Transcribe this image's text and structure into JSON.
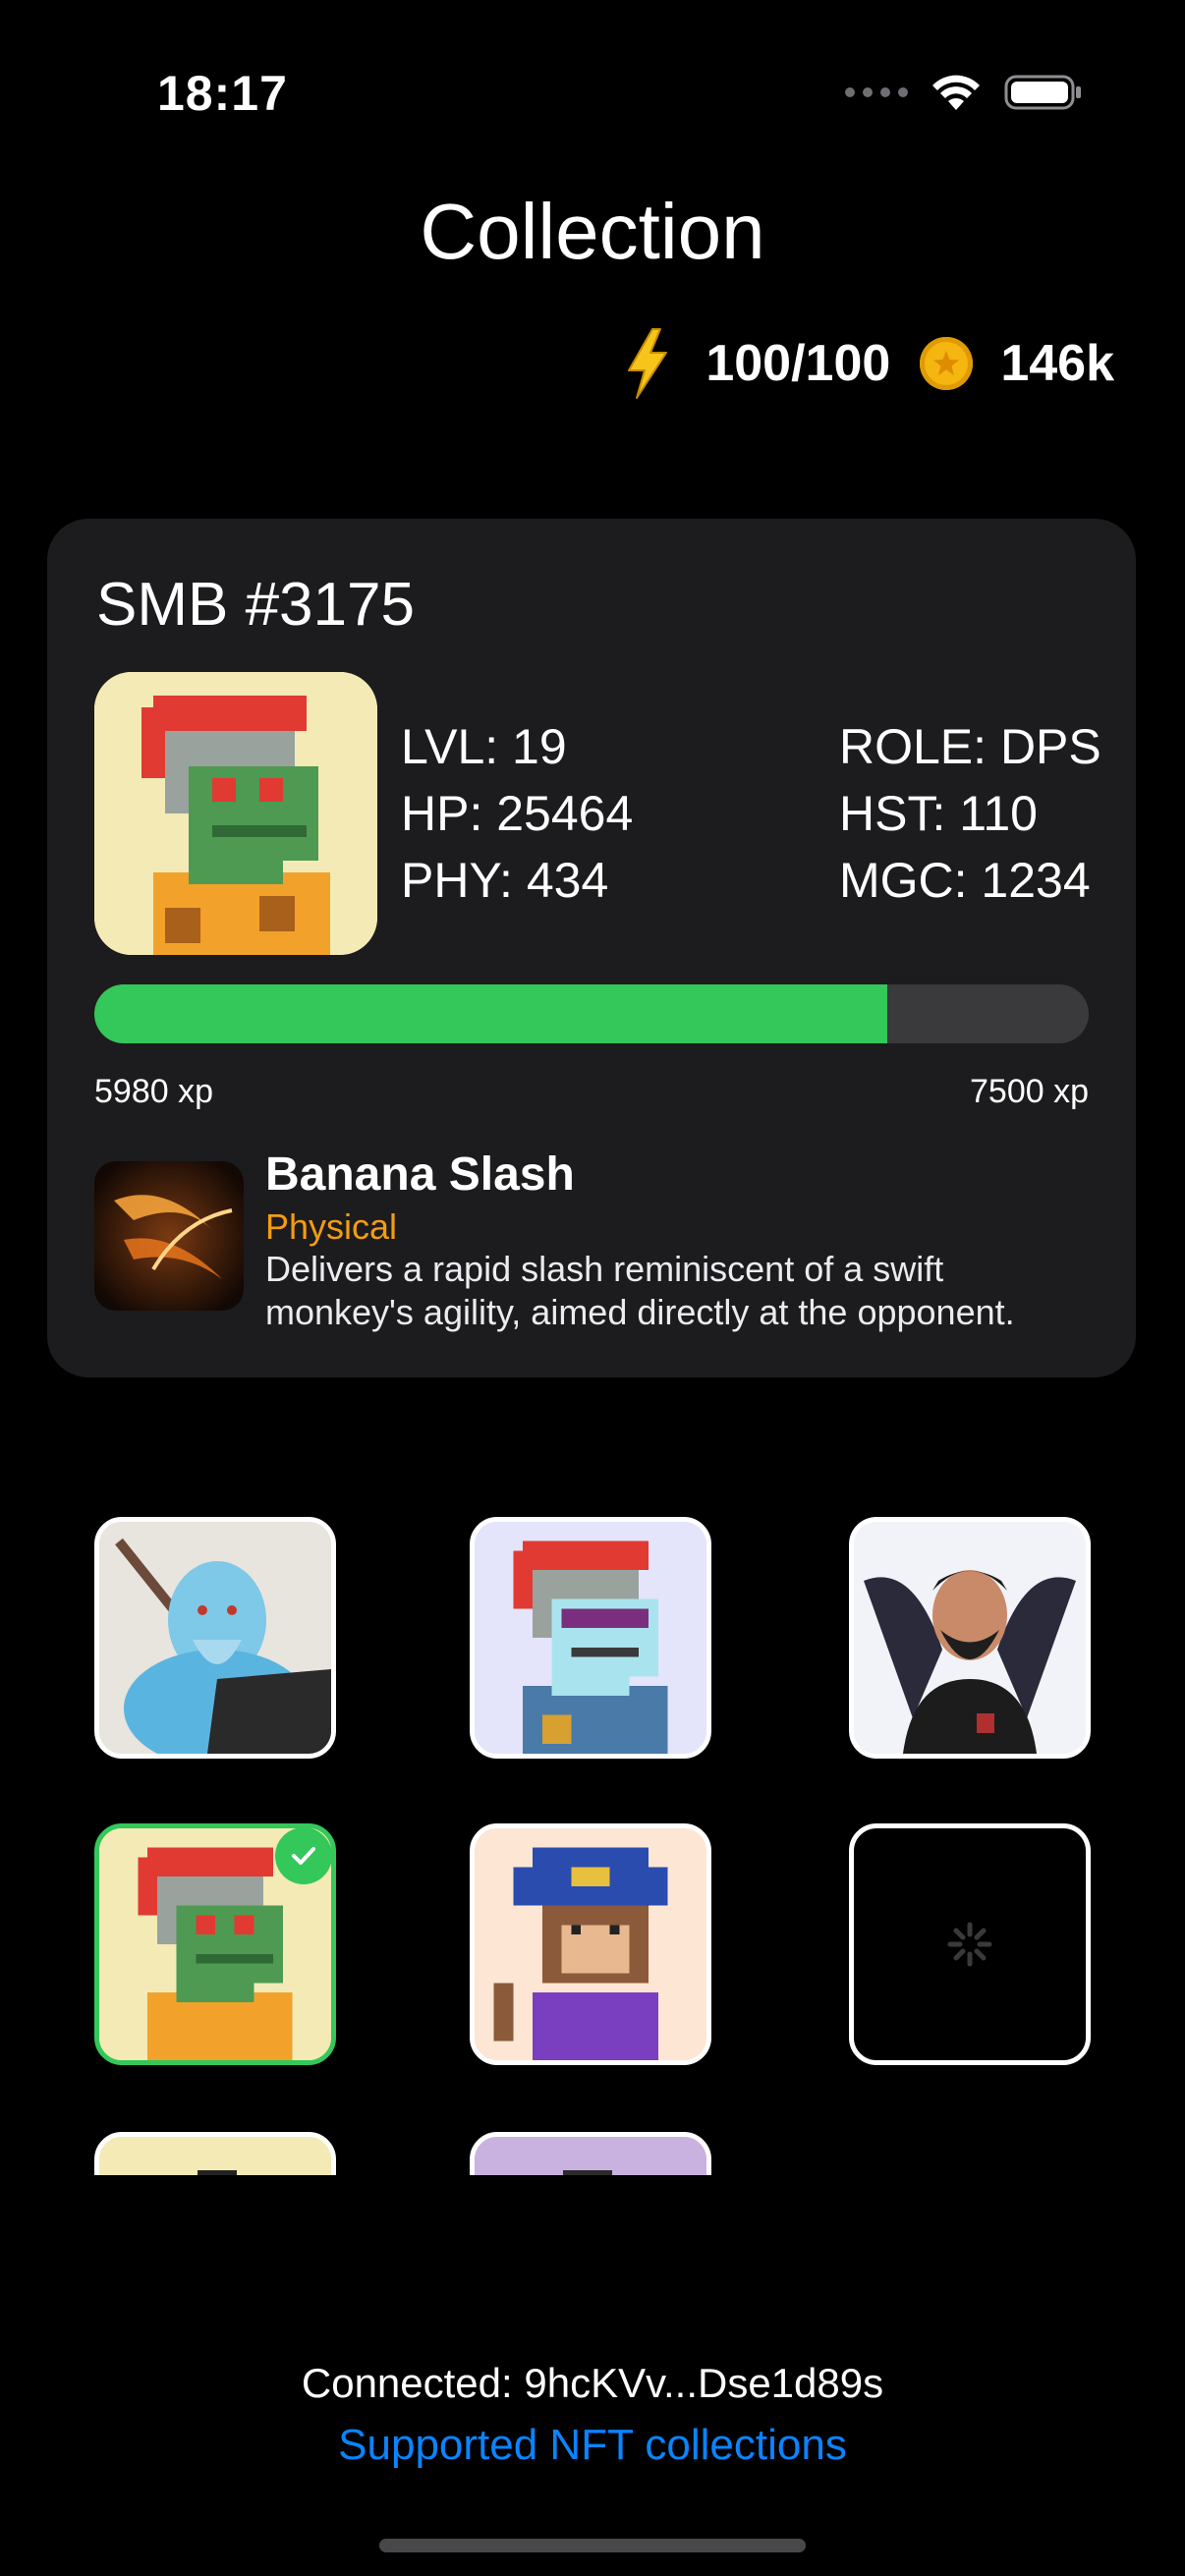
{
  "status_bar": {
    "time": "18:17",
    "icons": [
      "signal-dots-icon",
      "wifi-icon",
      "battery-icon"
    ]
  },
  "header": {
    "title": "Collection",
    "energy": "100/100",
    "coins": "146k",
    "energy_icon": "lightning-icon",
    "coin_icon": "coin-icon"
  },
  "card": {
    "name": "SMB #3175",
    "stats_left": [
      "LVL: 19",
      "HP: 25464",
      "PHY: 434"
    ],
    "stats_right": [
      "ROLE: DPS",
      "HST: 110",
      "MGC: 1234"
    ],
    "xp_current": "5980 xp",
    "xp_max": "7500 xp",
    "xp_progress": 0.797,
    "skill": {
      "name": "Banana Slash",
      "type": "Physical",
      "description": "Delivers a rapid slash reminiscent of a swift monkey's agility, aimed directly at the opponent."
    }
  },
  "grid": {
    "items": [
      {
        "avatar": "ice-warrior-avatar",
        "selected": false
      },
      {
        "avatar": "pixel-monkey-sunglasses-avatar",
        "selected": false
      },
      {
        "avatar": "winged-man-avatar",
        "selected": false
      },
      {
        "avatar": "pixel-monkey-green-avatar",
        "selected": true
      },
      {
        "avatar": "pixel-pirate-monkey-avatar",
        "selected": false
      },
      {
        "avatar": "loading-avatar",
        "selected": false
      },
      {
        "avatar": "partial-avatar-yellow",
        "selected": false
      },
      {
        "avatar": "partial-avatar-purple",
        "selected": false
      }
    ]
  },
  "footer": {
    "connected": "Connected: 9hcKVv...Dse1d89s",
    "supported_link": "Supported NFT collections"
  },
  "colors": {
    "accent_green": "#34c759",
    "link_blue": "#0a84ff",
    "skill_type_orange": "#f39c12",
    "card_bg": "#1c1c1e"
  }
}
